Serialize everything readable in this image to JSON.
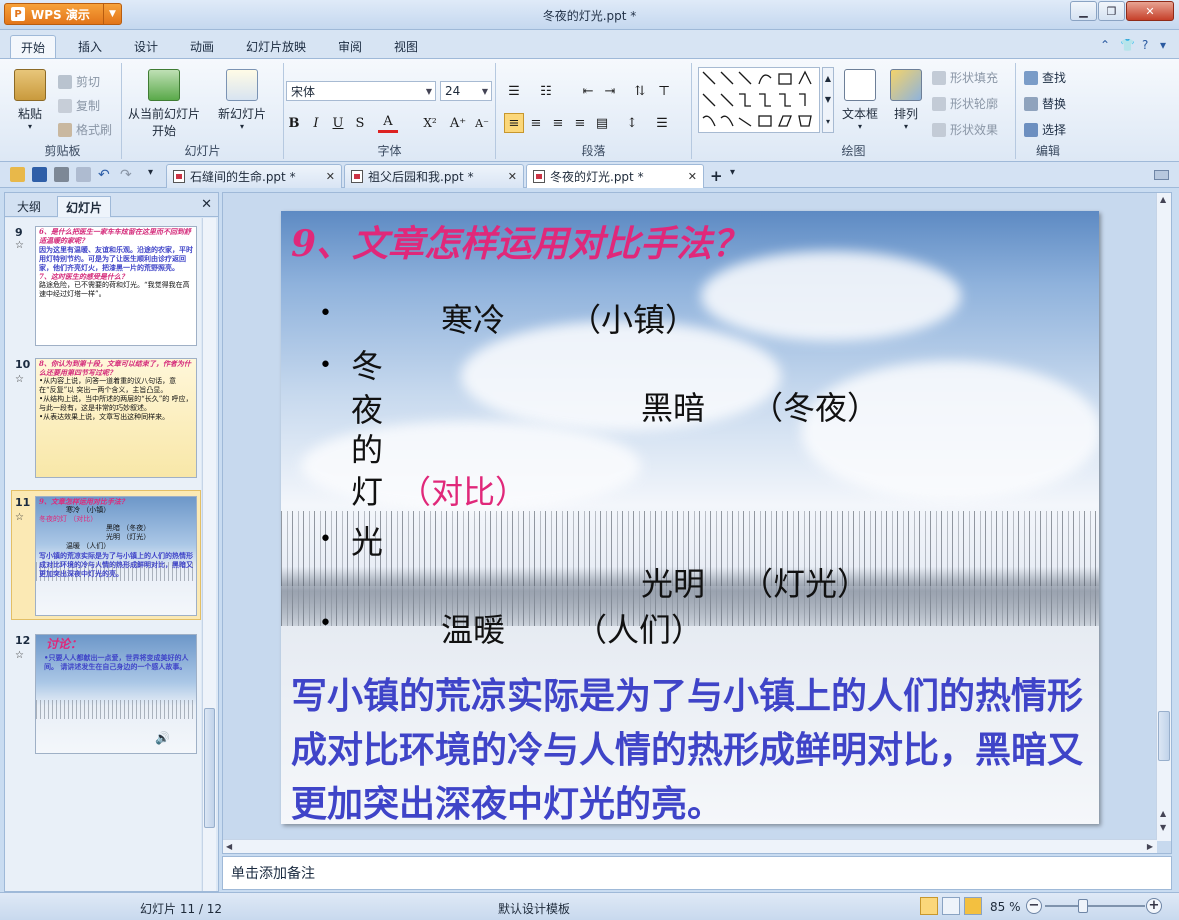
{
  "app": {
    "button_label": "WPS 演示",
    "window_title": "冬夜的灯光.ppt *"
  },
  "ribbon_tabs": [
    "开始",
    "插入",
    "设计",
    "动画",
    "幻灯片放映",
    "审阅",
    "视图"
  ],
  "clipboard": {
    "paste": "粘贴",
    "cut": "剪切",
    "copy": "复制",
    "format_painter": "格式刷",
    "label": "剪贴板"
  },
  "slides_group": {
    "from_current": "从当前幻灯片",
    "start": "开始",
    "new_slide": "新幻灯片",
    "label": "幻灯片"
  },
  "font": {
    "name": "宋体",
    "size": "24",
    "label": "字体",
    "bold": "B",
    "italic": "I",
    "underline": "U",
    "shadow": "S",
    "color": "A"
  },
  "paragraph": {
    "label": "段落"
  },
  "drawing": {
    "textbox": "文本框",
    "arrange": "排列",
    "shape_fill": "形状填充",
    "shape_outline": "形状轮廓",
    "shape_effect": "形状效果",
    "label": "绘图"
  },
  "editing": {
    "find": "查找",
    "replace": "替换",
    "select": "选择",
    "label": "编辑"
  },
  "doc_tabs": [
    {
      "title": "石缝间的生命.ppt *"
    },
    {
      "title": "祖父后园和我.ppt *"
    },
    {
      "title": "冬夜的灯光.ppt *"
    }
  ],
  "left_pane": {
    "tab_outline": "大纲",
    "tab_slides": "幻灯片"
  },
  "thumbnails": [
    {
      "num": "9",
      "lines": [
        "6、是什么把医生一家车车炫留在这里而不回到舒适温暖的家呢？",
        "因为这里有温暖、友谊和乐观。沿途的农家，平时用灯特别节约。可是为了让医生顺利由诊疗返回家，他们齐亮灯火，把漆黑一片的荒野照亮。",
        "7、这时医生的感受是什么？",
        "路途危险，已不需要的荷和灯光。“我觉得我在高速中经过灯塔一样”。"
      ]
    },
    {
      "num": "10",
      "lines": [
        "8、你认为到第十段，文章可以结束了，作者为什么还要用第四节写过呢？",
        "•从内容上说，问答一道着重的议八句话，意在“反复”以 突出一两个含义，主旨凸显。",
        "•从结构上说，当中所述的两层的“长久”的 呼应，与此一段有，这是非常的巧妙叙述。",
        "•从表达效果上说，文章写出这种同样来。"
      ]
    },
    {
      "num": "11",
      "lines": [
        "9、文章怎样运用对比手法？",
        "寒冷 （小镇）",
        "冬夜的灯 （对比）",
        "黑暗 （冬夜）",
        "光明 （灯光）",
        "温暖 （人们）",
        "写小镇的荒凉实际是为了与小镇上的人们的热情形成对比环境的冷与人情的热形成鲜明对比，黑暗又更加突出深夜中灯光的亮。"
      ]
    },
    {
      "num": "12",
      "lines": [
        "讨论：",
        "•只要人人都献出一点爱，世界将变成美好的人间。 请讲述发生在自己身边的一个感人故事。"
      ]
    }
  ],
  "slide": {
    "title": "9、文章怎样运用对比手法？",
    "b1_a": "寒冷",
    "b1_b": "（小镇）",
    "b2_chars": [
      "冬",
      "夜",
      "的"
    ],
    "b2_last": "灯",
    "b2_pink": "（对比）",
    "dark_a": "黑暗",
    "dark_b": "（冬夜）",
    "b3_char": "光",
    "light_a": "光明",
    "light_b": "（灯光）",
    "b4_a": "温暖",
    "b4_b": "（人们）",
    "bullet": "•",
    "summary": "写小镇的荒凉实际是为了与小镇上的人们的热情形成对比环境的冷与人情的热形成鲜明对比，黑暗又更加突出深夜中灯光的亮。"
  },
  "notes_placeholder": "单击添加备注",
  "status": {
    "slide_info": "幻灯片 11 / 12",
    "template": "默认设计模板",
    "zoom": "85 %"
  }
}
